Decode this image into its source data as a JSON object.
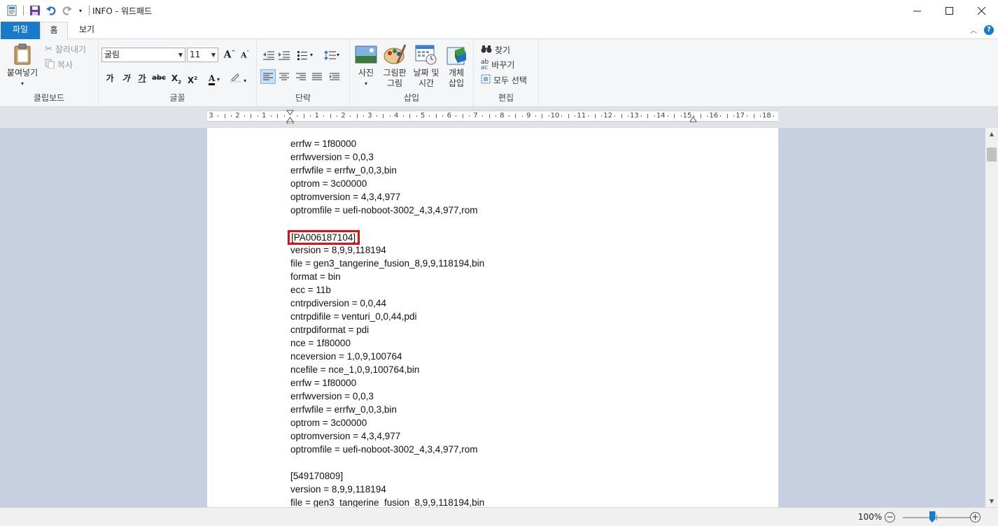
{
  "window": {
    "title": "INFO - 워드패드",
    "controls": [
      "minimize-icon",
      "maximize-icon",
      "close-icon"
    ]
  },
  "ribbon_tabs": [
    {
      "label": "파일"
    },
    {
      "label": "홈"
    },
    {
      "label": "보기"
    }
  ],
  "clipboard": {
    "paste": "붙여넣기",
    "cut": "잘라내기",
    "copy": "복사",
    "group": "클립보드"
  },
  "font": {
    "family": "굴림",
    "size": "11",
    "group": "글꼴",
    "bold": "가",
    "italic": "가",
    "underline": "가"
  },
  "paragraph": {
    "group": "단락"
  },
  "insert": {
    "picture": "사진",
    "paint_line1": "그림판",
    "paint_line2": "그림",
    "datetime_line1": "날짜 및",
    "datetime_line2": "시간",
    "object_line1": "개체",
    "object_line2": "삽입",
    "group": "삽입"
  },
  "editing": {
    "find": "찾기",
    "replace": "바꾸기",
    "select_all": "모두 선택",
    "group": "편집"
  },
  "ruler": {
    "labels": [
      "3",
      "2",
      "1",
      "1",
      "2",
      "3",
      "4",
      "5",
      "6",
      "7",
      "8",
      "9",
      "10",
      "11",
      "12",
      "13",
      "14",
      "15",
      "16",
      "17",
      "18"
    ]
  },
  "document": {
    "lines": [
      "errfw = 1f80000",
      "errfwversion = 0,0,3",
      "errfwfile = errfw_0,0,3,bin",
      "optrom = 3c00000",
      "optromversion = 4,3,4,977",
      "optromfile = uefi-noboot-3002_4,3,4,977,rom",
      "",
      "[PA006187104]",
      "version = 8,9,9,118194",
      "file = gen3_tangerine_fusion_8,9,9,118194,bin",
      "format = bin",
      "ecc = 11b",
      "cntrpdiversion = 0,0,44",
      "cntrpdifile = venturi_0,0,44,pdi",
      "cntrpdiformat = pdi",
      "nce = 1f80000",
      "nceversion = 1,0,9,100764",
      "ncefile = nce_1,0,9,100764,bin",
      "errfw = 1f80000",
      "errfwversion = 0,0,3",
      "errfwfile = errfw_0,0,3,bin",
      "optrom = 3c00000",
      "optromversion = 4,3,4,977",
      "optromfile = uefi-noboot-3002_4,3,4,977,rom",
      "",
      "[549170809]",
      "version = 8,9,9,118194",
      "file = gen3_tangerine_fusion_8,9,9,118194,bin"
    ],
    "highlighted_line_index": 7
  },
  "status": {
    "zoom": "100%",
    "zoom_level_fraction": 0.5
  },
  "colors": {
    "accent": "#1979ca",
    "highlight_box": "#e30e18",
    "workspace": "#c7d0e0"
  }
}
